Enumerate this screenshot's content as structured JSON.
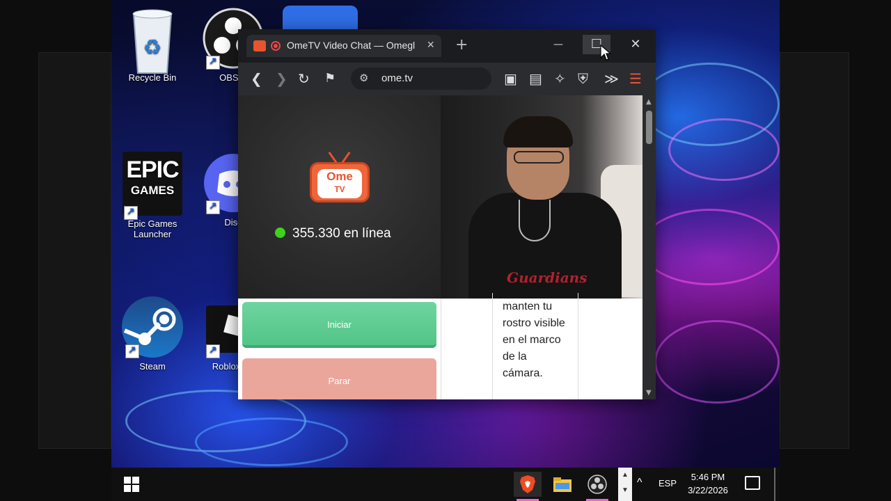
{
  "desktop": {
    "icons": [
      {
        "label": "Recycle Bin"
      },
      {
        "label": "OBS S"
      },
      {
        "label": "Epic Games Launcher"
      },
      {
        "label": "Disc"
      },
      {
        "label": "Steam"
      },
      {
        "label": "Roblox"
      }
    ],
    "epic_logo_line1": "EPIC",
    "epic_logo_line2": "GAMES"
  },
  "browser": {
    "tab_title": "OmeTV Video Chat — Omegl",
    "url": "ome.tv",
    "window_controls": {
      "minimize": "—",
      "maximize": "☐",
      "close": "✕"
    }
  },
  "page": {
    "logo_line1": "Ome",
    "logo_line2": "TV",
    "online_count": "355.330 en línea",
    "start_label": "Iniciar",
    "stop_label": "Parar",
    "chat_message": "manten tu rostro visible en el marco de la cámara.",
    "shirt_text": "Guardians"
  },
  "taskbar": {
    "language": "ESP",
    "time": "5:46 PM",
    "date": "3/22/2026"
  },
  "colors": {
    "accent_green": "#52c587",
    "stop_red": "#eba69b",
    "brand_orange": "#e7542d",
    "online_dot": "#3fd21a"
  }
}
